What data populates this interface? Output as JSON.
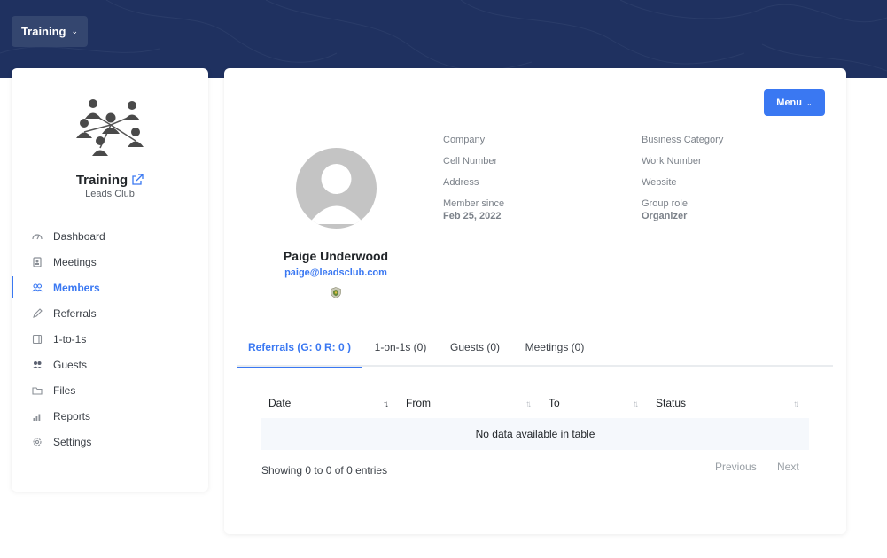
{
  "header": {
    "group_label": "Training"
  },
  "sidebar": {
    "club_name": "Training",
    "club_subtitle": "Leads Club",
    "items": [
      {
        "label": "Dashboard",
        "icon": "dashboard-icon"
      },
      {
        "label": "Meetings",
        "icon": "meetings-icon"
      },
      {
        "label": "Members",
        "icon": "members-icon",
        "active": true
      },
      {
        "label": "Referrals",
        "icon": "pencil-icon"
      },
      {
        "label": "1-to-1s",
        "icon": "one-to-one-icon"
      },
      {
        "label": "Guests",
        "icon": "guests-icon"
      },
      {
        "label": "Files",
        "icon": "folder-icon"
      },
      {
        "label": "Reports",
        "icon": "bar-chart-icon"
      },
      {
        "label": "Settings",
        "icon": "gear-icon"
      }
    ]
  },
  "profile": {
    "menu_label": "Menu",
    "name": "Paige Underwood",
    "email": "paige@leadsclub.com",
    "left_fields": {
      "company": "Company",
      "cell": "Cell Number",
      "address": "Address",
      "member_since_label": "Member since",
      "member_since_value": "Feb 25, 2022"
    },
    "right_fields": {
      "category": "Business Category",
      "work": "Work Number",
      "website": "Website",
      "role_label": "Group role",
      "role_value": "Organizer"
    }
  },
  "tabs": [
    {
      "label": "Referrals (G: 0 R: 0 )",
      "active": true
    },
    {
      "label": "1-on-1s (0)"
    },
    {
      "label": "Guests (0)"
    },
    {
      "label": "Meetings (0)"
    }
  ],
  "table": {
    "columns": [
      "Date",
      "From",
      "To",
      "Status"
    ],
    "empty_text": "No data available in table",
    "info": "Showing 0 to 0 of 0 entries",
    "previous": "Previous",
    "next": "Next"
  },
  "colors": {
    "banner": "#1f3160",
    "accent": "#3a78f2"
  }
}
